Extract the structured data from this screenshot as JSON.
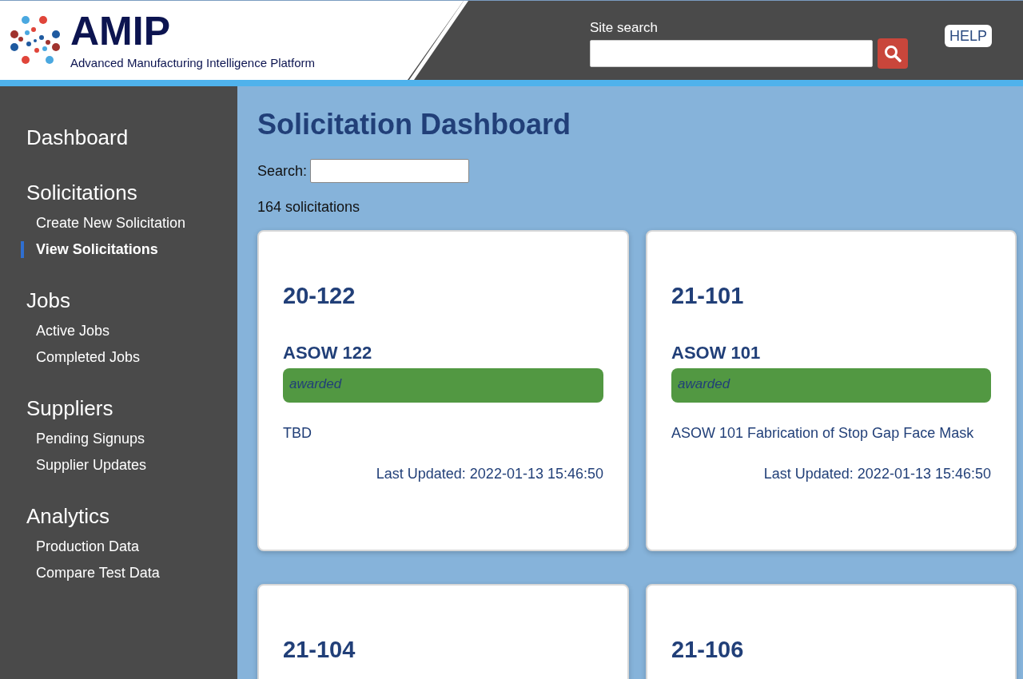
{
  "header": {
    "logo_text": "AMIP",
    "tagline": "Advanced Manufacturing Intelligence Platform",
    "search_label": "Site search",
    "help": "HELP"
  },
  "sidebar": [
    {
      "heading": "Dashboard"
    },
    {
      "heading": "Solicitations",
      "items": [
        {
          "label": "Create New Solicitation",
          "selected": false
        },
        {
          "label": "View Solicitations",
          "selected": true
        }
      ]
    },
    {
      "heading": "Jobs",
      "items": [
        {
          "label": "Active Jobs",
          "selected": false
        },
        {
          "label": "Completed Jobs",
          "selected": false
        }
      ]
    },
    {
      "heading": "Suppliers",
      "items": [
        {
          "label": "Pending Signups",
          "selected": false
        },
        {
          "label": "Supplier Updates",
          "selected": false
        }
      ]
    },
    {
      "heading": "Analytics",
      "items": [
        {
          "label": "Production Data",
          "selected": false
        },
        {
          "label": "Compare Test Data",
          "selected": false
        }
      ]
    }
  ],
  "main": {
    "title": "Solicitation Dashboard",
    "search_label": "Search:",
    "count": "164 solicitations"
  },
  "cards": [
    {
      "number": "20-122",
      "name": "ASOW 122",
      "status": "awarded",
      "color": "#529842",
      "description": "TBD",
      "updated": "Last Updated: 2022-01-13 15:46:50"
    },
    {
      "number": "21-101",
      "name": "ASOW 101",
      "status": "awarded",
      "color": "#529842",
      "description": "ASOW 101 Fabrication of Stop Gap Face Mask",
      "updated": "Last Updated: 2022-01-13 15:46:50"
    },
    {
      "number": "21-104"
    },
    {
      "number": "21-106"
    }
  ]
}
